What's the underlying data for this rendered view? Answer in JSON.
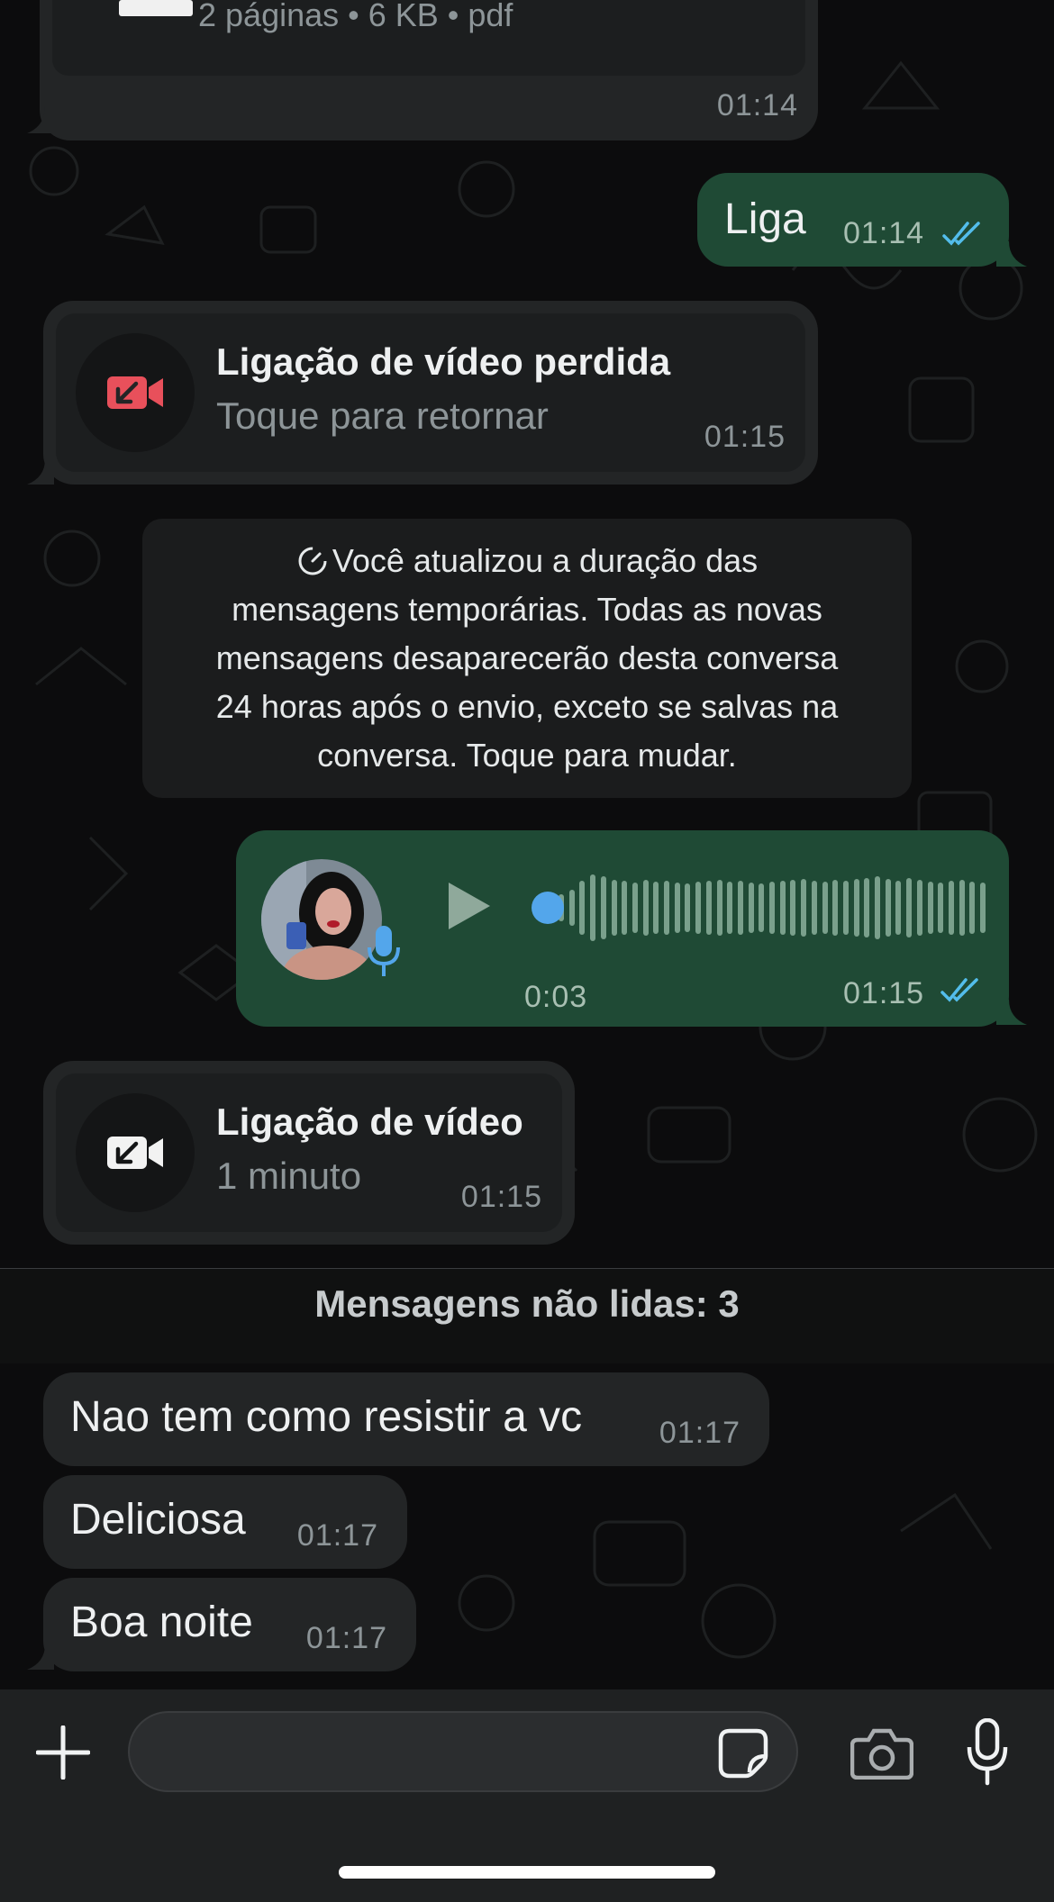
{
  "document_message": {
    "meta": "2 páginas • 6 KB • pdf",
    "time": "01:14"
  },
  "outgoing_text": {
    "text": "Liga",
    "time": "01:14"
  },
  "missed_call": {
    "title": "Ligação de vídeo perdida",
    "subtitle": "Toque para retornar",
    "time": "01:15"
  },
  "system_note": {
    "lines": [
      "Você atualizou a duração das",
      "mensagens temporárias. Todas as novas",
      "mensagens desaparecerão desta conversa",
      "24 horas após o envio, exceto se salvas na",
      "conversa. Toque para mudar."
    ]
  },
  "voice_message": {
    "duration": "0:03",
    "time": "01:15",
    "progress": 0
  },
  "video_call": {
    "title": "Ligação de vídeo",
    "subtitle": "1 minuto",
    "time": "01:15"
  },
  "unread": {
    "label": "Mensagens não lidas: 3"
  },
  "incoming_messages": [
    {
      "text": "Nao tem como resistir a vc",
      "time": "01:17"
    },
    {
      "text": "Deliciosa",
      "time": "01:17"
    },
    {
      "text": "Boa noite",
      "time": "01:17"
    }
  ],
  "colors": {
    "outgoing_bubble": "#1f4a35",
    "incoming_bubble": "#232526",
    "read_ticks": "#53bdeb",
    "missed_call_red": "#e8505b"
  }
}
